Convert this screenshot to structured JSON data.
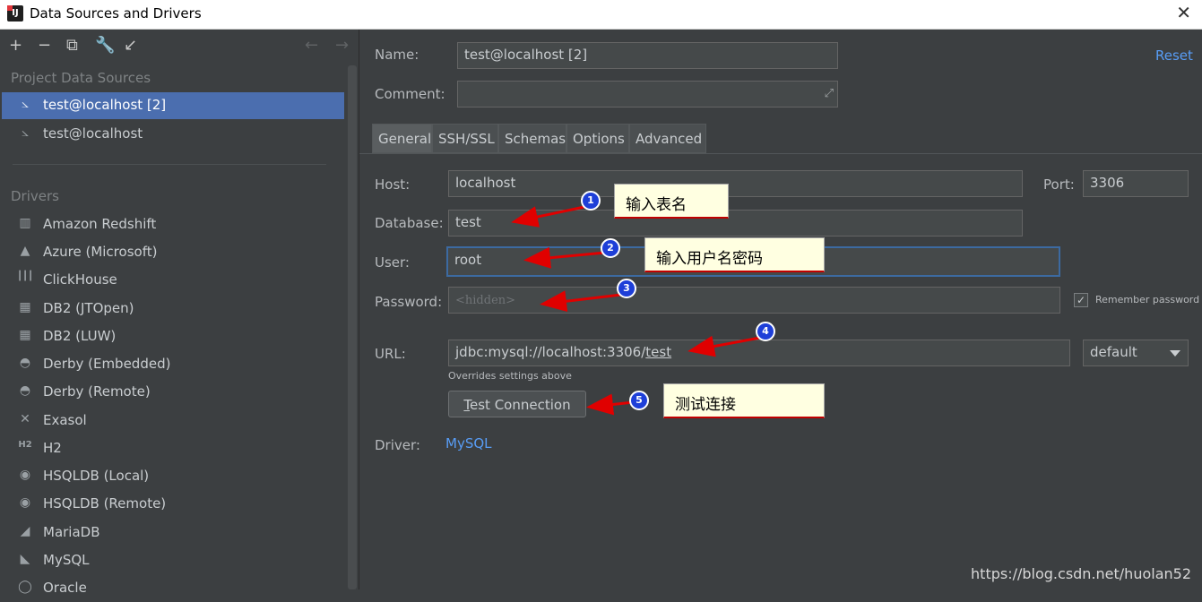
{
  "window": {
    "title": "Data Sources and Drivers",
    "close": "✕"
  },
  "toolbar": {
    "add": "+",
    "remove": "−",
    "copy": "⧉",
    "settings": "🔧",
    "import": "↙",
    "back": "←",
    "forward": "→"
  },
  "left": {
    "project_heading": "Project Data Sources",
    "project_items": [
      {
        "label": "test@localhost [2]"
      },
      {
        "label": "test@localhost"
      }
    ],
    "drivers_heading": "Drivers",
    "drivers": [
      {
        "label": "Amazon Redshift",
        "icon": "▥"
      },
      {
        "label": "Azure (Microsoft)",
        "icon": "▲"
      },
      {
        "label": "ClickHouse",
        "icon": "┃┃┃"
      },
      {
        "label": "DB2 (JTOpen)",
        "icon": "▦"
      },
      {
        "label": "DB2 (LUW)",
        "icon": "▦"
      },
      {
        "label": "Derby (Embedded)",
        "icon": "◓"
      },
      {
        "label": "Derby (Remote)",
        "icon": "◓"
      },
      {
        "label": "Exasol",
        "icon": "✕"
      },
      {
        "label": "H2",
        "icon": "H2"
      },
      {
        "label": "HSQLDB (Local)",
        "icon": "◉"
      },
      {
        "label": "HSQLDB (Remote)",
        "icon": "◉"
      },
      {
        "label": "MariaDB",
        "icon": "◢"
      },
      {
        "label": "MySQL",
        "icon": "◣"
      },
      {
        "label": "Oracle",
        "icon": "◯"
      }
    ]
  },
  "form": {
    "name_label": "Name:",
    "name_value": "test@localhost [2]",
    "reset": "Reset",
    "comment_label": "Comment:",
    "comment_value": "",
    "tabs": [
      "General",
      "SSH/SSL",
      "Schemas",
      "Options",
      "Advanced"
    ],
    "host_label": "Host:",
    "host_value": "localhost",
    "port_label": "Port:",
    "port_value": "3306",
    "database_label": "Database:",
    "database_value": "test",
    "user_label": "User:",
    "user_value": "root",
    "password_label": "Password:",
    "password_placeholder": "<hidden>",
    "remember_password": "Remember password",
    "remember_checked": "✓",
    "url_label": "URL:",
    "url_prefix": "jdbc:mysql://localhost:3306/",
    "url_db": "test",
    "url_mode": "default",
    "url_hint": "Overrides settings above",
    "test_button_accel": "T",
    "test_button_rest": "est Connection",
    "driver_label": "Driver:",
    "driver_value": "MySQL"
  },
  "annotations": [
    {
      "num": "1",
      "text": "输入表名"
    },
    {
      "num": "2",
      "text": "输入用户名密码"
    },
    {
      "num": "3",
      "text": ""
    },
    {
      "num": "4",
      "text": ""
    },
    {
      "num": "5",
      "text": "测试连接"
    }
  ],
  "watermark": "https://blog.csdn.net/huolan52",
  "colors": {
    "background": "#3c3f41",
    "selection": "#4b6eaf",
    "link": "#589df6",
    "annotation_arrow": "#e00000",
    "annotation_badge": "#1e3fd8"
  }
}
